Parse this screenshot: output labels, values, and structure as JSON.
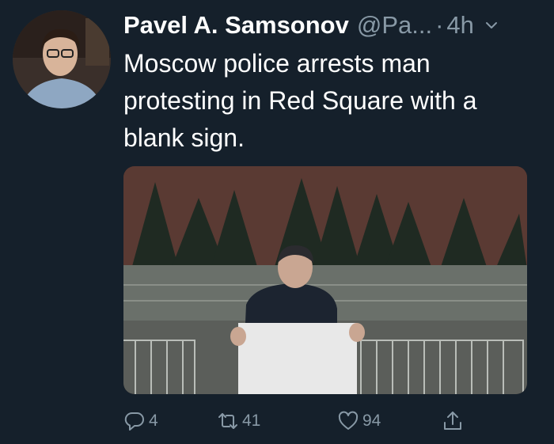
{
  "tweet": {
    "author_name": "Pavel A. Samsonov",
    "handle": "@Pa...",
    "separator": "·",
    "time": "4h",
    "text": "Moscow police arrests man protesting in Red Square with a blank sign.",
    "actions": {
      "replies": "4",
      "retweets": "41",
      "likes": "94"
    }
  },
  "icons": [
    "chevron-down-icon",
    "reply-icon",
    "retweet-icon",
    "like-icon",
    "share-icon"
  ],
  "colors": {
    "background": "#15202b",
    "primary_text": "#ffffff",
    "secondary_text": "#8899a6"
  }
}
